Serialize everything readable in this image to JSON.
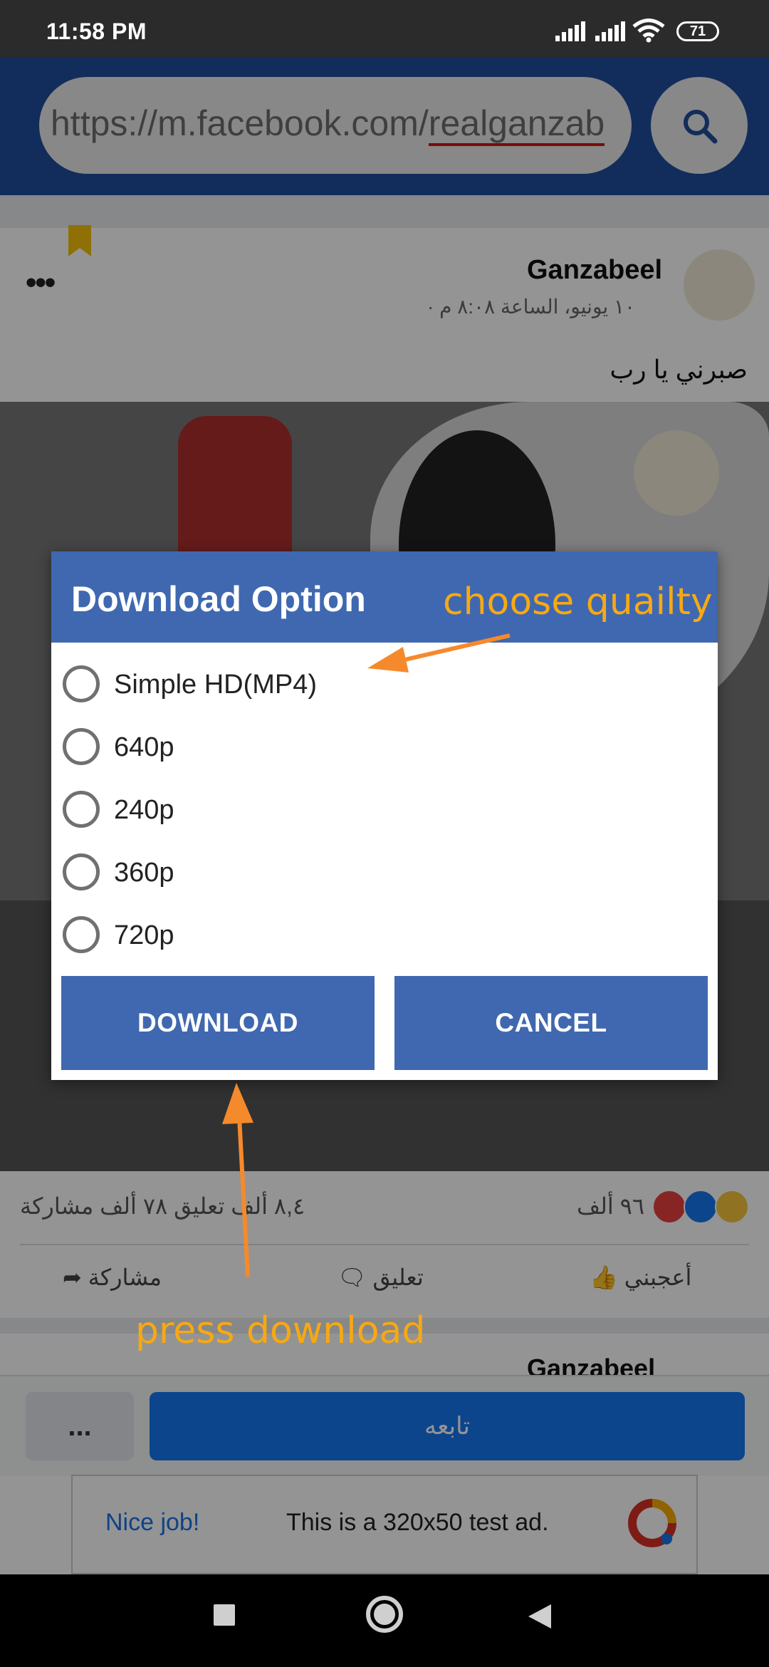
{
  "status_bar": {
    "time": "11:58 PM",
    "battery": "71"
  },
  "browser": {
    "url_prefix": "https://m.facebook.com/",
    "url_underlined": "realganzab"
  },
  "post": {
    "author": "Ganzabeel",
    "date": "١٠ يونيو، الساعة ٨:٠٨ م ·",
    "text": "صبرني يا رب",
    "reactions_count": "٩٦ ألف",
    "comments_shares": "٨,٤ ألف تعليق   ٧٨ ألف مشاركة",
    "actions": {
      "like": "أعجبني",
      "comment": "تعليق",
      "share": "مشاركة"
    },
    "next_author_peek": "Ganzabeel"
  },
  "bottom_bar": {
    "more_label": "...",
    "follow_label": "تابعه"
  },
  "ad": {
    "nice": "Nice job!",
    "text": "This is a 320x50 test ad."
  },
  "dialog": {
    "title": "Download Option",
    "options": [
      "Simple HD(MP4)",
      "640p",
      "240p",
      "360p",
      "720p"
    ],
    "download_label": "DOWNLOAD",
    "cancel_label": "CANCEL"
  },
  "annotations": {
    "top": "choose quailty",
    "bottom": "press download"
  },
  "colors": {
    "annotation": "#f7a912",
    "dialog_accent": "#4068b0",
    "topbar": "#1f4f9d"
  }
}
